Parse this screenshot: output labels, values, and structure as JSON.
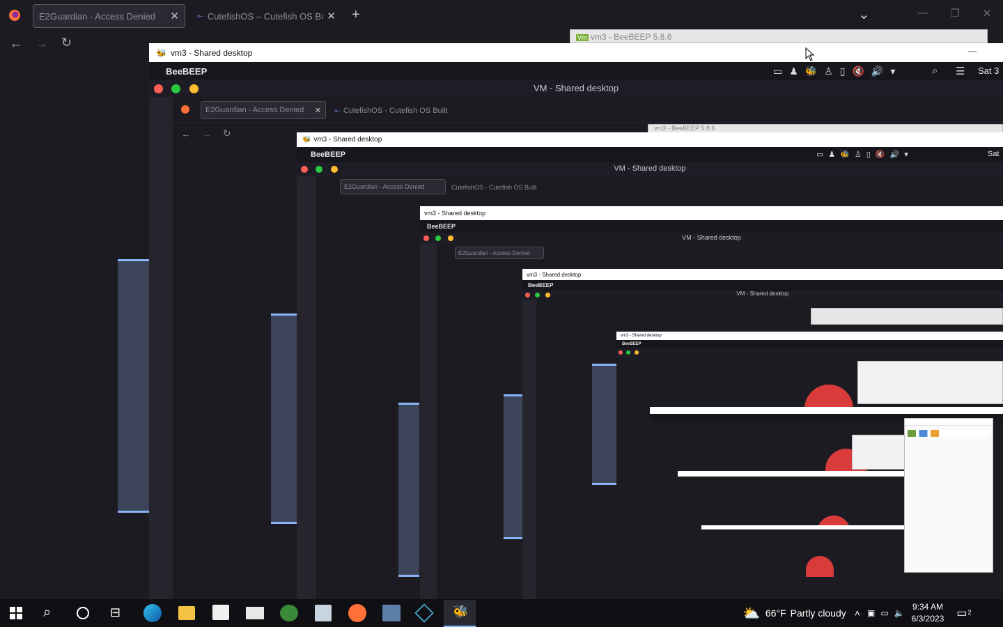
{
  "outer_browser": {
    "tabs": [
      {
        "label": "E2Guardian - Access Denied"
      },
      {
        "label": "CutefishOS – Cutefish OS Built"
      }
    ],
    "new_tab": "+",
    "list_all_tabs": "⌄",
    "window_controls": {
      "minimize": "—",
      "maximize": "❐",
      "close": "✕"
    },
    "nav": {
      "back": "←",
      "forward": "→",
      "reload": "↻"
    }
  },
  "vm_window": {
    "title": "vm3 - Shared desktop",
    "background_window_title": "vm3 - BeeBEEP 5.8.6",
    "minimize": "—"
  },
  "shared_desktop": {
    "app_name": "BeeBEEP",
    "clock": "Sat 3",
    "mac_title": "VM - Shared desktop",
    "nested_tabs": [
      {
        "label": "E2Guardian - Access Denied"
      },
      {
        "label": "CutefishOS - Cutefish OS Built"
      }
    ],
    "level2_clock": "Sat"
  },
  "taskbar": {
    "weather_temp": "66°F",
    "weather_desc": "Partly cloudy",
    "time": "9:34 AM",
    "date": "6/3/2023",
    "notification_count": "2"
  },
  "colors": {
    "accent": "#89b4f8",
    "traffic_red": "#ff5f57",
    "traffic_green": "#28c840",
    "traffic_yellow": "#febc2e",
    "taskbar_bg": "#101014"
  },
  "icons": [
    "firefox-icon",
    "back-arrow-icon",
    "forward-arrow-icon",
    "reload-icon",
    "apple-icon",
    "windows-start-icon",
    "search-icon",
    "cortana-icon",
    "task-view-icon",
    "edge-icon",
    "file-explorer-icon",
    "store-icon",
    "mail-icon",
    "beebeep-icon",
    "weather-icon",
    "chevron-up-icon",
    "network-icon",
    "volume-icon",
    "notification-icon"
  ]
}
